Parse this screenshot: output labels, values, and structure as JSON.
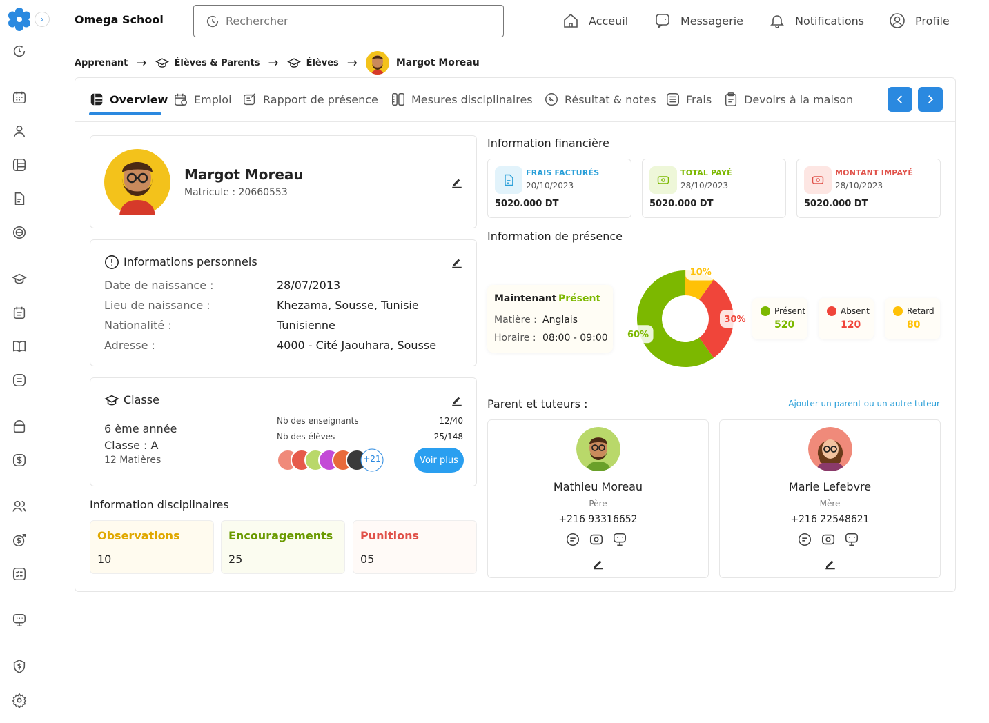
{
  "app": {
    "brand": "Omega School"
  },
  "search": {
    "placeholder": "Rechercher"
  },
  "nav": {
    "home": "Acceuil",
    "messages": "Messagerie",
    "notifications": "Notifications",
    "profile": "Profile"
  },
  "breadcrumb": {
    "items": [
      "Apprenant",
      "Élèves & Parents",
      "Élèves",
      "Margot Moreau"
    ]
  },
  "tabs": [
    "Overview",
    "Emploi",
    "Rapport de présence",
    "Mesures disciplinaires",
    "Résultat & notes",
    "Frais",
    "Devoirs à la maison"
  ],
  "student": {
    "name": "Margot Moreau",
    "matricule": "Matricule : 20660553"
  },
  "personal": {
    "title": "Informations personnels",
    "rows": [
      {
        "label": "Date de naissance :",
        "value": "28/07/2013"
      },
      {
        "label": "Lieu de naissance :",
        "value": "Khezama, Sousse, Tunisie"
      },
      {
        "label": "Nationalité :",
        "value": "Tunisienne"
      },
      {
        "label": "Adresse :",
        "value": "4000 - Cité Jaouhara, Sousse"
      }
    ]
  },
  "classe": {
    "title": "Classe",
    "level": "6 ème année",
    "group": "Classe : A",
    "subjects": "12 Matières",
    "teachers_label": "Nb des enseignants",
    "teachers_value": "12/40",
    "students_label": "Nb des élèves",
    "students_value": "25/148",
    "more_count": "+21",
    "more_button": "Voir plus"
  },
  "discipline": {
    "title": "Information disciplinaires",
    "items": [
      {
        "label": "Observations",
        "value": "10",
        "color": "#e0a800"
      },
      {
        "label": "Encouragements",
        "value": "25",
        "color": "#6a9a00"
      },
      {
        "label": "Punitions",
        "value": "05",
        "color": "#e0524a"
      }
    ]
  },
  "finance": {
    "title": "Information financière",
    "items": [
      {
        "label": "FRAIS FACTURÉS",
        "date": "20/10/2023",
        "amount": "5020.000 DT",
        "color": "#2a9fd8"
      },
      {
        "label": "TOTAL PAYÉ",
        "date": "28/10/2023",
        "amount": "5020.000 DT",
        "color": "#7cb800"
      },
      {
        "label": "MONTANT IMPAYÉ",
        "date": "28/10/2023",
        "amount": "5020.000 DT",
        "color": "#e0524a"
      }
    ]
  },
  "presence": {
    "title": "Information de présence",
    "now_label": "Maintenant",
    "now_status": "Présent",
    "subject_label": "Matière :",
    "subject_value": "Anglais",
    "time_label": "Horaire :",
    "time_value": "08:00 - 09:00",
    "legend": [
      {
        "label": "Présent",
        "value": "520",
        "color": "#7cb800"
      },
      {
        "label": "Absent",
        "value": "120",
        "color": "#f0453a"
      },
      {
        "label": "Retard",
        "value": "80",
        "color": "#ffc107"
      }
    ]
  },
  "chart_data": {
    "type": "pie",
    "categories": [
      "Présent",
      "Absent",
      "Retard"
    ],
    "values": [
      60,
      30,
      10
    ],
    "labels": [
      "60%",
      "30%",
      "10%"
    ],
    "colors": [
      "#7cb800",
      "#f0453a",
      "#ffc107"
    ]
  },
  "parents": {
    "title": "Parent et tuteurs :",
    "add_link": "Ajouter un parent ou un autre tuteur",
    "items": [
      {
        "name": "Mathieu Moreau",
        "role": "Père",
        "phone": "+216 93316652"
      },
      {
        "name": "Marie Lefebvre",
        "role": "Mère",
        "phone": "+216 22548621"
      }
    ]
  }
}
